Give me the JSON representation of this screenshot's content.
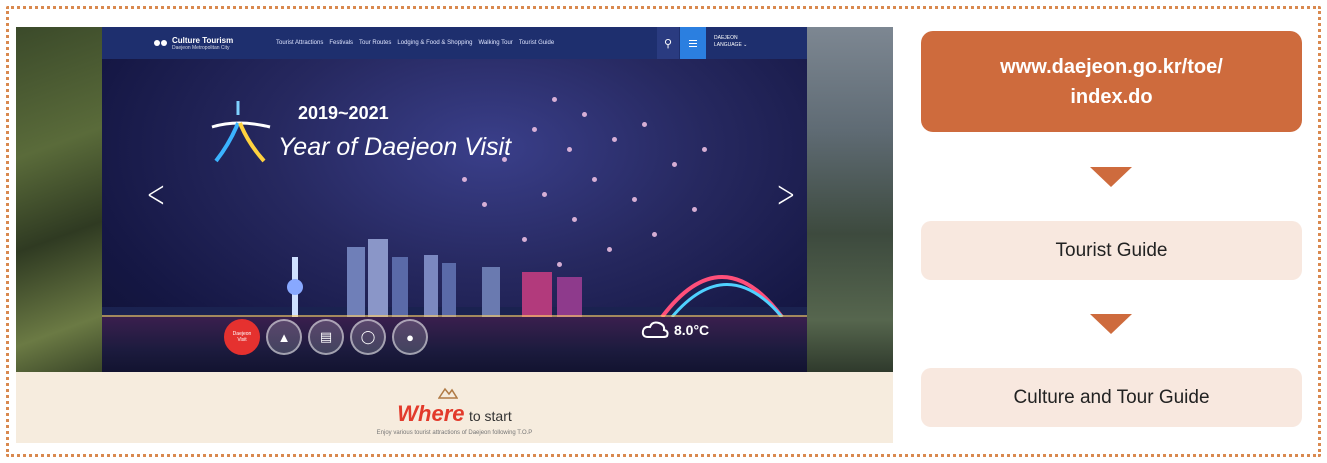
{
  "site": {
    "logo_title": "Culture Tourism",
    "logo_subtitle": "Daejeon Metropolitan City",
    "nav": [
      "Tourist Attractions",
      "Festivals",
      "Tour Routes",
      "Lodging & Food & Shopping",
      "Walking Tour",
      "Tourist Guide"
    ],
    "lang_top": "DAEJEON",
    "lang_bottom": "LANGUAGE ⌄"
  },
  "hero": {
    "years": "2019~2021",
    "campaign": "Year of Daejeon Visit",
    "prev_icon": "chevron-left-icon",
    "next_icon": "chevron-right-icon",
    "active_circle_label": "Daejeon Visit",
    "temperature": "8.0°C"
  },
  "where": {
    "big": "Where",
    "small": "to start",
    "sub": "Enjoy various tourist attractions of Daejeon following T.O.P"
  },
  "flow": {
    "url": "www.daejeon.go.kr/toe/ index.do",
    "step1": "Tourist Guide",
    "step2": "Culture and Tour Guide"
  },
  "colors": {
    "accent": "#ce6b3d",
    "step_bg": "#f8e8df",
    "frame": "#d9894f",
    "nav_bg": "#1e2f6e"
  }
}
